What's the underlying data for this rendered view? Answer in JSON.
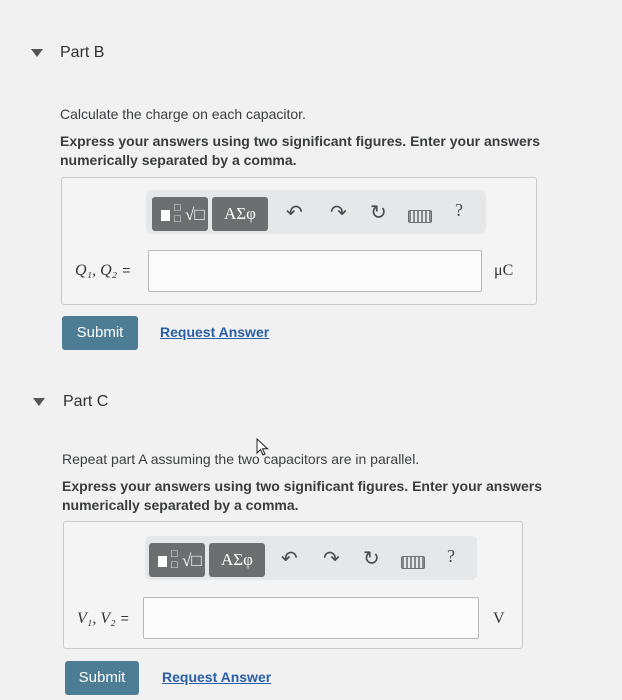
{
  "partB": {
    "title": "Part B",
    "prompt": "Calculate the charge on each capacitor.",
    "instruction": "Express your answers using two significant figures. Enter your answers numerically separated by a comma.",
    "toolbar": {
      "templates_icon": "templates-fraction-root-icon",
      "greek_label": "ΑΣφ",
      "undo_icon": "undo-icon",
      "redo_icon": "redo-icon",
      "reset_icon": "reset-icon",
      "keyboard_icon": "keyboard-icon",
      "help_label": "?"
    },
    "variable_label": "Q₁, Q₂",
    "equals": "=",
    "input_value": "",
    "unit": "μC",
    "submit_label": "Submit",
    "request_label": "Request Answer"
  },
  "partC": {
    "title": "Part C",
    "prompt": "Repeat part A assuming the two capacitors are in parallel.",
    "instruction": "Express your answers using two significant figures. Enter your answers numerically separated by a comma.",
    "toolbar": {
      "templates_icon": "templates-fraction-root-icon",
      "greek_label": "ΑΣφ",
      "undo_icon": "undo-icon",
      "redo_icon": "redo-icon",
      "reset_icon": "reset-icon",
      "keyboard_icon": "keyboard-icon",
      "help_label": "?"
    },
    "variable_label": "V₁, V₂",
    "equals": "=",
    "input_value": "",
    "unit": "V",
    "submit_label": "Submit",
    "request_label": "Request Answer"
  },
  "colors": {
    "submit_bg": "#4c7d94",
    "link": "#2a5ea6",
    "toolbar_button": "#6c6e70"
  }
}
